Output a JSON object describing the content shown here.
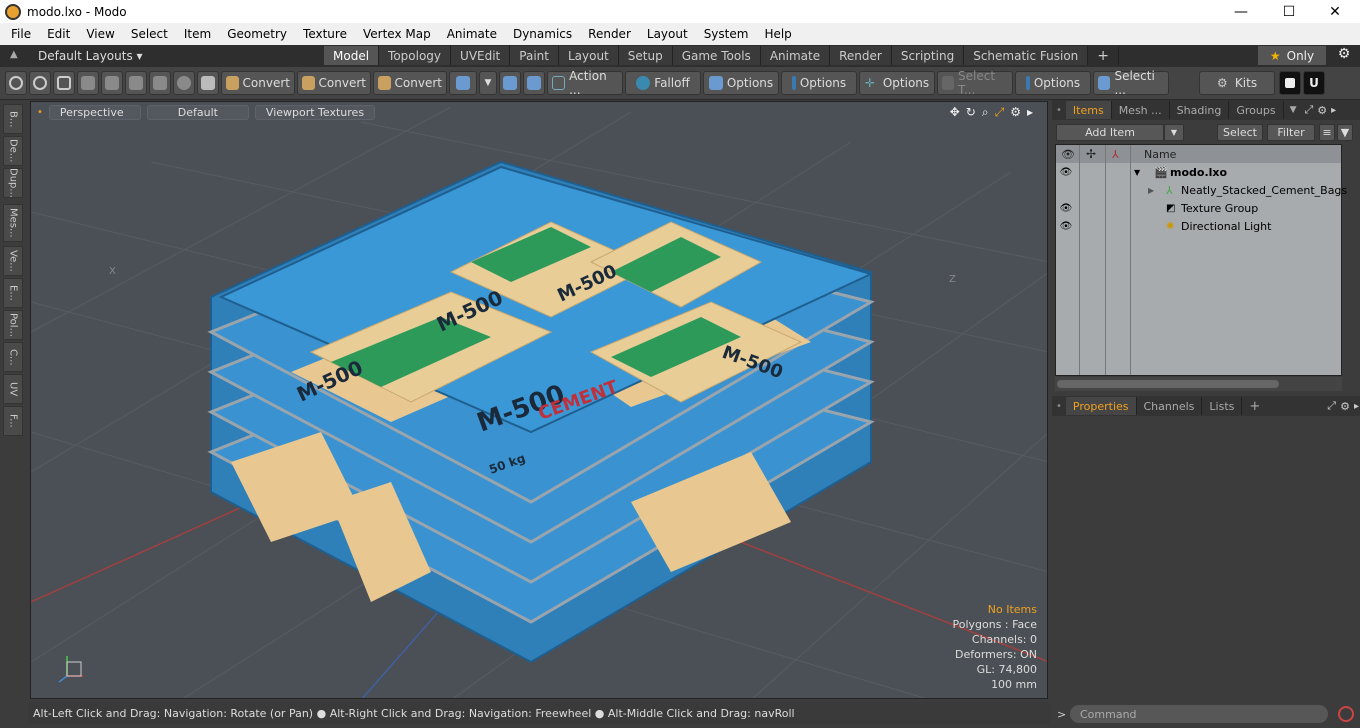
{
  "window": {
    "title": "modo.lxo - Modo",
    "minimize": "—",
    "maximize": "☐",
    "close": "✕"
  },
  "menu": [
    "File",
    "Edit",
    "View",
    "Select",
    "Item",
    "Geometry",
    "Texture",
    "Vertex Map",
    "Animate",
    "Dynamics",
    "Render",
    "Layout",
    "System",
    "Help"
  ],
  "layout_selector": "Default Layouts ▾",
  "layout_tabs": [
    "Model",
    "Topology",
    "UVEdit",
    "Paint",
    "Layout",
    "Setup",
    "Game Tools",
    "Animate",
    "Render",
    "Scripting",
    "Schematic Fusion",
    "+"
  ],
  "active_layout_tab": "Model",
  "only_label": "Only",
  "toolbar": {
    "convert1": "Convert",
    "convert2": "Convert",
    "convert3": "Convert",
    "action": "Action ...",
    "falloff": "Falloff",
    "options1": "Options",
    "options2": "Options",
    "options3": "Options",
    "select_t": "Select T...",
    "options4": "Options",
    "selecti": "Selecti ...",
    "kits": "Kits"
  },
  "left_tabs": [
    "B...",
    "De...",
    "Dup...",
    "Mes...",
    "Ve...",
    "E...",
    "Pol...",
    "C...",
    "UV",
    "F..."
  ],
  "viewport": {
    "view_mode": "Perspective",
    "shading": "Default",
    "textures": "Viewport Textures",
    "info": {
      "no_items": "No Items",
      "polygons": "Polygons : Face",
      "channels": "Channels: 0",
      "deformers": "Deformers: ON",
      "gl": "GL: 74,800",
      "units": "100 mm"
    },
    "axis_labels": {
      "x_left": "X",
      "z_right": "Z"
    }
  },
  "status": "Alt-Left Click and Drag: Navigation: Rotate (or Pan) ● Alt-Right Click and Drag: Navigation: Freewheel ● Alt-Middle Click and Drag: navRoll",
  "panel_tabs": [
    "Items",
    "Mesh ...",
    "Shading",
    "Groups"
  ],
  "items_bar": {
    "add_item": "Add Item",
    "select": "Select",
    "filter": "Filter"
  },
  "tree": {
    "name_header": "Name",
    "rows": [
      {
        "label": "modo.lxo",
        "visible": true
      },
      {
        "label": "Neatly_Stacked_Cement_Bags",
        "visible": false
      },
      {
        "label": "Texture Group",
        "visible": true
      },
      {
        "label": "Directional Light",
        "visible": true
      }
    ]
  },
  "prop_tabs": [
    "Properties",
    "Channels",
    "Lists",
    "+"
  ],
  "command_placeholder": "Command"
}
